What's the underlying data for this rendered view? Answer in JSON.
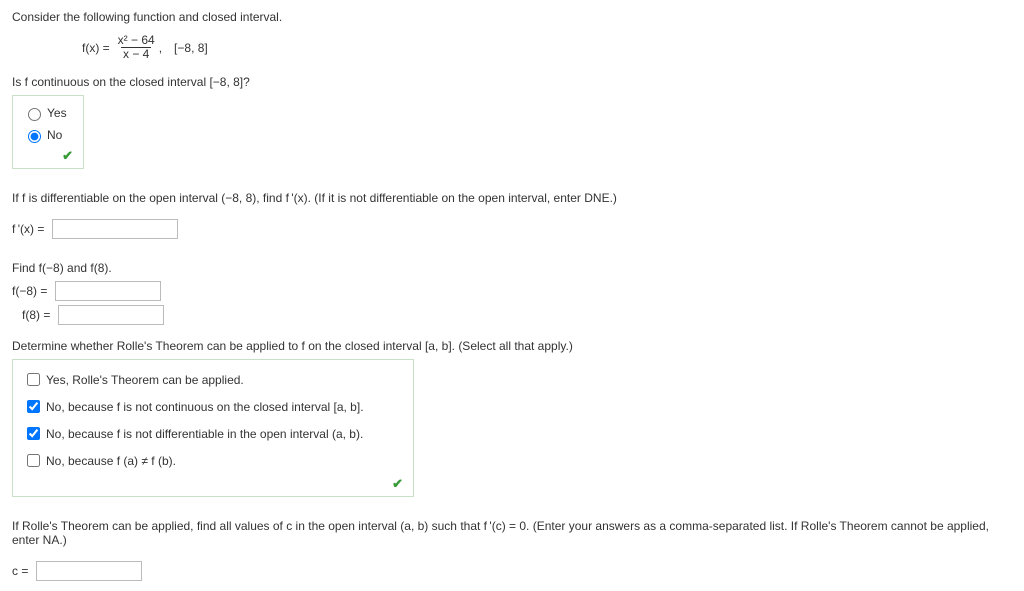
{
  "intro": "Consider the following function and closed interval.",
  "function": {
    "fx_label": "f(x) =",
    "numerator": "x² − 64",
    "denominator": "x − 4",
    "trailing_comma": ",",
    "interval": "[−8, 8]"
  },
  "q_continuous": {
    "prompt": "Is f continuous on the closed interval [−8, 8]?",
    "options": {
      "yes": "Yes",
      "no": "No"
    }
  },
  "q_diff": {
    "prompt": "If f is differentiable on the open interval (−8, 8), find f '(x). (If it is not differentiable on the open interval, enter DNE.)",
    "label": "f '(x) ="
  },
  "q_eval": {
    "prompt": "Find f(−8) and f(8).",
    "label_a": "f(−8)  =",
    "label_b": "f(8)  ="
  },
  "q_rolle": {
    "prompt": "Determine whether Rolle's Theorem can be applied to f on the closed interval [a, b]. (Select all that apply.)",
    "opt1": "Yes, Rolle's Theorem can be applied.",
    "opt2": "No, because f is not continuous on the closed interval [a, b].",
    "opt3": "No, because f is not differentiable in the open interval (a, b).",
    "opt4": "No, because f (a) ≠ f (b)."
  },
  "q_c": {
    "prompt": "If Rolle's Theorem can be applied, find all values of c in the open interval (a, b) such that f '(c) = 0. (Enter your answers as a comma-separated list. If Rolle's Theorem cannot be applied, enter NA.)",
    "label": "c ="
  }
}
